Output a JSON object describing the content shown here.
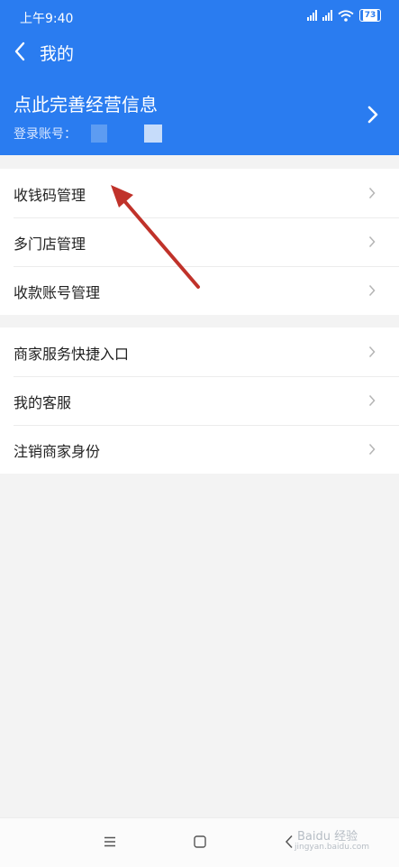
{
  "status_bar": {
    "time": "上午9:40",
    "battery": "73"
  },
  "header": {
    "title": "我的"
  },
  "profile": {
    "title": "点此完善经营信息",
    "account_label": "登录账号："
  },
  "menu_group_1": [
    {
      "label": "收钱码管理"
    },
    {
      "label": "多门店管理"
    },
    {
      "label": "收款账号管理"
    }
  ],
  "menu_group_2": [
    {
      "label": "商家服务快捷入口"
    },
    {
      "label": "我的客服"
    },
    {
      "label": "注销商家身份"
    }
  ],
  "watermark": {
    "brand": "Baidu 经验",
    "url": "jingyan.baidu.com"
  },
  "colors": {
    "header_bg": "#2a7cf0",
    "page_bg": "#f3f3f3",
    "annotation_arrow": "#c0322a"
  }
}
